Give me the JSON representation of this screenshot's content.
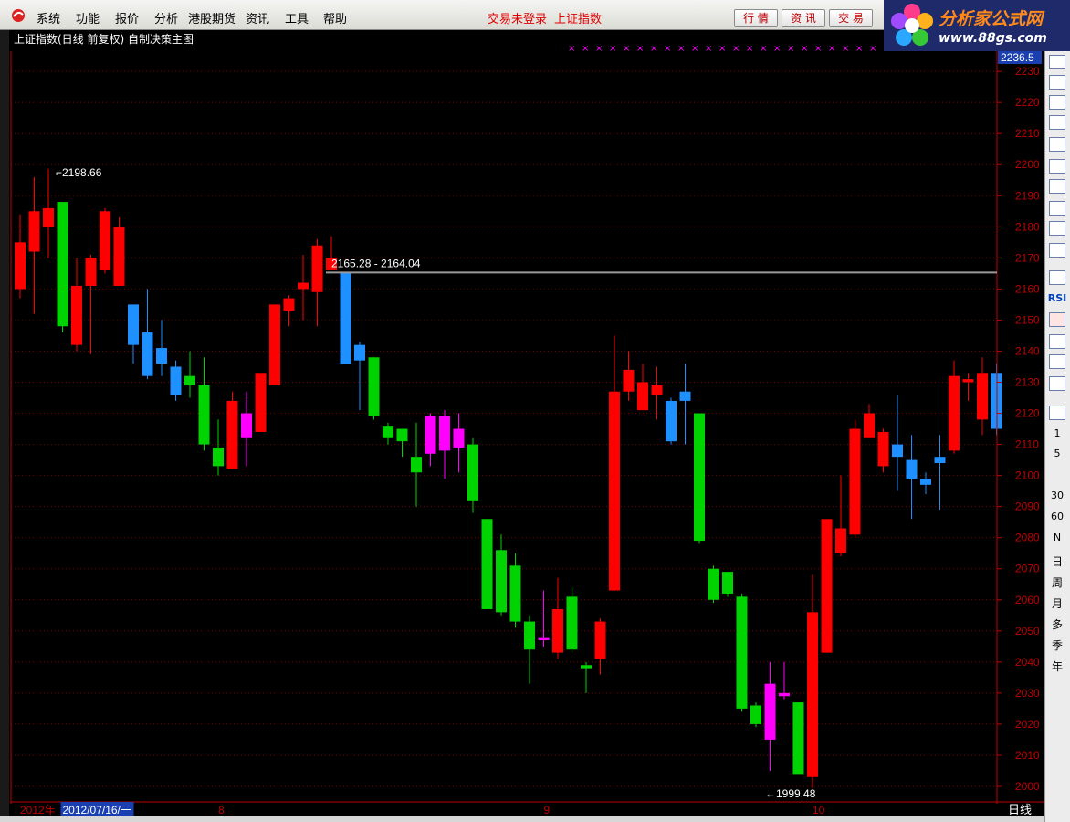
{
  "menu": {
    "items": [
      "系统",
      "功能",
      "报价",
      "分析",
      "港股期货",
      "资讯",
      "工具",
      "帮助"
    ],
    "status_login": "交易未登录",
    "status_index": "上证指数",
    "buttons": [
      "行 情",
      "资 讯",
      "交 易"
    ]
  },
  "brand": {
    "name": "分析家公式网",
    "url": "www.88gs.com"
  },
  "chart_title": "上证指数(日线 前复权) 自制决策主图",
  "right_toolbar": {
    "labels": [
      "RSI",
      "1",
      "5",
      "30",
      "60",
      "N",
      "日",
      "周",
      "月",
      "多",
      "季",
      "年"
    ]
  },
  "colors": {
    "up": "#ff0000",
    "down": "#00d400",
    "blue": "#1e90ff",
    "magenta": "#ff00ff",
    "axis": "#c00000",
    "grid": "#7a0000"
  },
  "chart_data": {
    "type": "candlestick",
    "ylim": [
      1995,
      2236.5
    ],
    "current_value_label": "2236.5",
    "y_ticks": [
      2230,
      2220,
      2210,
      2200,
      2190,
      2180,
      2170,
      2160,
      2150,
      2140,
      2130,
      2120,
      2110,
      2100,
      2090,
      2080,
      2070,
      2060,
      2050,
      2040,
      2030,
      2020,
      2010,
      2000
    ],
    "x_labels": [
      {
        "text": "2012年",
        "index": 0
      },
      {
        "text": "2012/07/16/一",
        "index": 3
      },
      {
        "text": "8",
        "index": 14
      },
      {
        "text": "9",
        "index": 37
      },
      {
        "text": "10",
        "index": 56
      }
    ],
    "period_label": "日线",
    "annotations": [
      {
        "text": "2198.66",
        "index": 2,
        "value": 2198.66
      },
      {
        "text": "2165.28 - 2164.04",
        "index": 22,
        "value": 2165.28
      },
      {
        "text": "1999.48",
        "index": 52,
        "value": 1999.48
      }
    ],
    "candles": [
      {
        "o": 2160,
        "h": 2184,
        "l": 2157,
        "c": 2175,
        "k": "up"
      },
      {
        "o": 2172,
        "h": 2196,
        "l": 2152,
        "c": 2185,
        "k": "up"
      },
      {
        "o": 2180,
        "h": 2198.66,
        "l": 2170,
        "c": 2186,
        "k": "up"
      },
      {
        "o": 2188,
        "h": 2188,
        "l": 2146,
        "c": 2148,
        "k": "down"
      },
      {
        "o": 2142,
        "h": 2170,
        "l": 2140,
        "c": 2161,
        "k": "up"
      },
      {
        "o": 2161,
        "h": 2171,
        "l": 2139,
        "c": 2170,
        "k": "up"
      },
      {
        "o": 2166,
        "h": 2186,
        "l": 2165,
        "c": 2185,
        "k": "up"
      },
      {
        "o": 2161,
        "h": 2183,
        "l": 2161,
        "c": 2180,
        "k": "up"
      },
      {
        "o": 2155,
        "h": 2155,
        "l": 2136,
        "c": 2142,
        "k": "blue"
      },
      {
        "o": 2146,
        "h": 2160,
        "l": 2131,
        "c": 2132,
        "k": "blue"
      },
      {
        "o": 2141,
        "h": 2150,
        "l": 2132,
        "c": 2136,
        "k": "blue"
      },
      {
        "o": 2135,
        "h": 2137,
        "l": 2124,
        "c": 2126,
        "k": "blue"
      },
      {
        "o": 2132,
        "h": 2140,
        "l": 2125,
        "c": 2129,
        "k": "down"
      },
      {
        "o": 2129,
        "h": 2138,
        "l": 2108,
        "c": 2110,
        "k": "down"
      },
      {
        "o": 2109,
        "h": 2118,
        "l": 2100,
        "c": 2103,
        "k": "down"
      },
      {
        "o": 2102,
        "h": 2127,
        "l": 2102,
        "c": 2124,
        "k": "up"
      },
      {
        "o": 2120,
        "h": 2127,
        "l": 2103,
        "c": 2112,
        "k": "magenta"
      },
      {
        "o": 2114,
        "h": 2133,
        "l": 2114,
        "c": 2133,
        "k": "up"
      },
      {
        "o": 2129,
        "h": 2155,
        "l": 2129,
        "c": 2155,
        "k": "up"
      },
      {
        "o": 2153,
        "h": 2158,
        "l": 2148,
        "c": 2157,
        "k": "up"
      },
      {
        "o": 2160,
        "h": 2171,
        "l": 2150,
        "c": 2162,
        "k": "up"
      },
      {
        "o": 2159,
        "h": 2176,
        "l": 2148,
        "c": 2174,
        "k": "up"
      },
      {
        "o": 2170,
        "h": 2177,
        "l": 2166,
        "c": 2166,
        "k": "up"
      },
      {
        "o": 2165.28,
        "h": 2165.28,
        "l": 2136,
        "c": 2136,
        "k": "blue"
      },
      {
        "o": 2142,
        "h": 2143,
        "l": 2121,
        "c": 2137,
        "k": "blue"
      },
      {
        "o": 2138,
        "h": 2138,
        "l": 2118,
        "c": 2119,
        "k": "down"
      },
      {
        "o": 2116,
        "h": 2117,
        "l": 2110,
        "c": 2112,
        "k": "down"
      },
      {
        "o": 2115,
        "h": 2115,
        "l": 2106,
        "c": 2111,
        "k": "down"
      },
      {
        "o": 2106,
        "h": 2117,
        "l": 2090,
        "c": 2101,
        "k": "down"
      },
      {
        "o": 2119,
        "h": 2120,
        "l": 2103,
        "c": 2107,
        "k": "magenta"
      },
      {
        "o": 2119,
        "h": 2121,
        "l": 2099,
        "c": 2108,
        "k": "magenta"
      },
      {
        "o": 2115,
        "h": 2120,
        "l": 2101,
        "c": 2109,
        "k": "magenta"
      },
      {
        "o": 2110,
        "h": 2112,
        "l": 2088,
        "c": 2092,
        "k": "down"
      },
      {
        "o": 2086,
        "h": 2086,
        "l": 2057,
        "c": 2057,
        "k": "down"
      },
      {
        "o": 2076,
        "h": 2081,
        "l": 2055,
        "c": 2056,
        "k": "down"
      },
      {
        "o": 2071,
        "h": 2075,
        "l": 2051,
        "c": 2053,
        "k": "down"
      },
      {
        "o": 2053,
        "h": 2055,
        "l": 2033,
        "c": 2044,
        "k": "down"
      },
      {
        "o": 2048,
        "h": 2063,
        "l": 2045,
        "c": 2047,
        "k": "magenta"
      },
      {
        "o": 2043,
        "h": 2067,
        "l": 2041,
        "c": 2057,
        "k": "up"
      },
      {
        "o": 2061,
        "h": 2064,
        "l": 2043,
        "c": 2044,
        "k": "down"
      },
      {
        "o": 2039,
        "h": 2040,
        "l": 2030,
        "c": 2038,
        "k": "down"
      },
      {
        "o": 2041,
        "h": 2054,
        "l": 2036,
        "c": 2053,
        "k": "up"
      },
      {
        "o": 2063,
        "h": 2145,
        "l": 2063,
        "c": 2127,
        "k": "up"
      },
      {
        "o": 2127,
        "h": 2140,
        "l": 2124,
        "c": 2134,
        "k": "up"
      },
      {
        "o": 2121,
        "h": 2136,
        "l": 2121,
        "c": 2130,
        "k": "up"
      },
      {
        "o": 2126,
        "h": 2135,
        "l": 2118,
        "c": 2129,
        "k": "up"
      },
      {
        "o": 2124,
        "h": 2125,
        "l": 2110,
        "c": 2111,
        "k": "blue"
      },
      {
        "o": 2124,
        "h": 2136,
        "l": 2110,
        "c": 2127,
        "k": "blue"
      },
      {
        "o": 2120,
        "h": 2120,
        "l": 2078,
        "c": 2079,
        "k": "down"
      },
      {
        "o": 2070,
        "h": 2071,
        "l": 2059,
        "c": 2060,
        "k": "down"
      },
      {
        "o": 2069,
        "h": 2069,
        "l": 2061,
        "c": 2062,
        "k": "down"
      },
      {
        "o": 2061,
        "h": 2062,
        "l": 2024,
        "c": 2025,
        "k": "down"
      },
      {
        "o": 2026,
        "h": 2027,
        "l": 2019,
        "c": 2020,
        "k": "down"
      },
      {
        "o": 2033,
        "h": 2040,
        "l": 2005,
        "c": 2015,
        "k": "magenta"
      },
      {
        "o": 2029,
        "h": 2040,
        "l": 2028,
        "c": 2030,
        "k": "magenta"
      },
      {
        "o": 2027,
        "h": 2027,
        "l": 2004,
        "c": 2004,
        "k": "down"
      },
      {
        "o": 2003,
        "h": 2068,
        "l": 1999.48,
        "c": 2056,
        "k": "up"
      },
      {
        "o": 2043,
        "h": 2080,
        "l": 2043,
        "c": 2086,
        "k": "up"
      },
      {
        "o": 2075,
        "h": 2100,
        "l": 2074,
        "c": 2083,
        "k": "up"
      },
      {
        "o": 2081,
        "h": 2118,
        "l": 2080,
        "c": 2115,
        "k": "up"
      },
      {
        "o": 2112,
        "h": 2123,
        "l": 2112,
        "c": 2120,
        "k": "up"
      },
      {
        "o": 2103,
        "h": 2115,
        "l": 2101,
        "c": 2114,
        "k": "up"
      },
      {
        "o": 2110,
        "h": 2126,
        "l": 2095,
        "c": 2106,
        "k": "blue"
      },
      {
        "o": 2105,
        "h": 2113,
        "l": 2086,
        "c": 2099,
        "k": "blue"
      },
      {
        "o": 2099,
        "h": 2101,
        "l": 2094,
        "c": 2097,
        "k": "blue"
      },
      {
        "o": 2104,
        "h": 2113,
        "l": 2089,
        "c": 2106,
        "k": "blue"
      },
      {
        "o": 2108,
        "h": 2137,
        "l": 2107,
        "c": 2132,
        "k": "up"
      },
      {
        "o": 2130,
        "h": 2133,
        "l": 2124,
        "c": 2131,
        "k": "up"
      },
      {
        "o": 2118,
        "h": 2138,
        "l": 2113,
        "c": 2133,
        "k": "up"
      },
      {
        "o": 2133,
        "h": 2136,
        "l": 2113,
        "c": 2115,
        "k": "blue"
      }
    ]
  }
}
